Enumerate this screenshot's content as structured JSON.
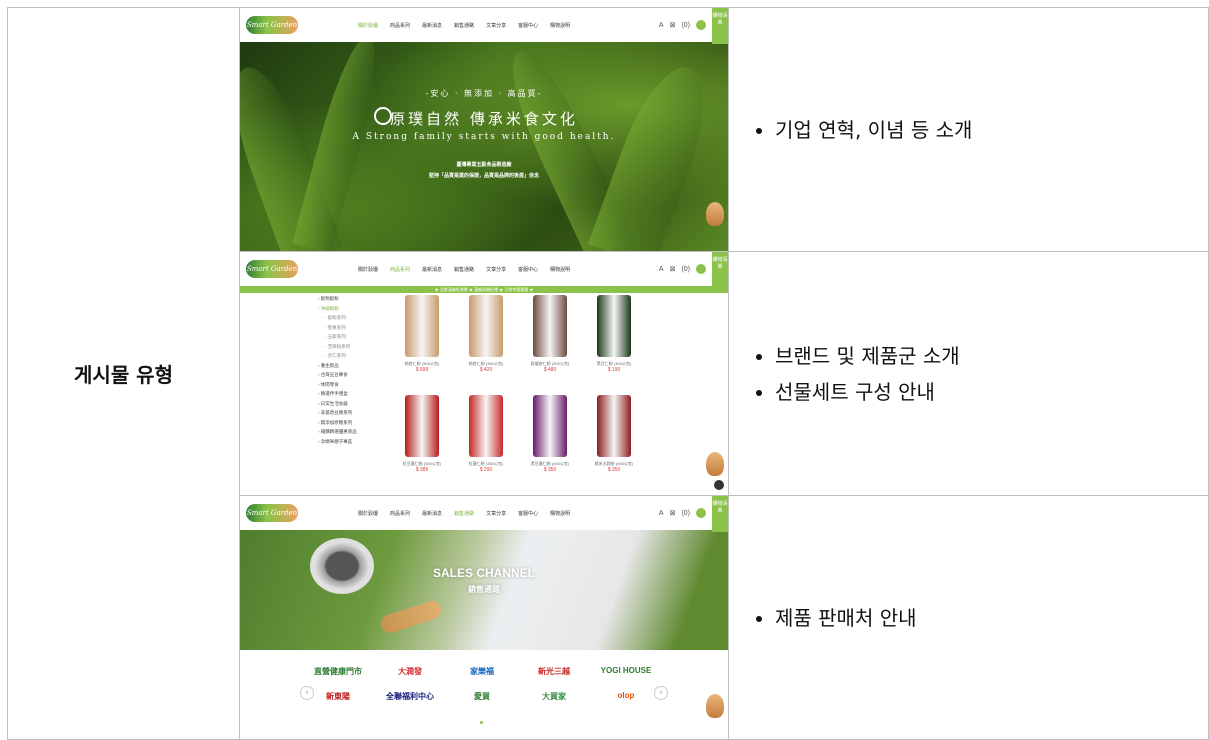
{
  "row_label": "게시물 유형",
  "rows": [
    {
      "bullets": [
        "기업 연혁, 이념 등 소개"
      ]
    },
    {
      "bullets": [
        "브랜드 및 제품군 소개",
        "선물세트 구성 안내"
      ]
    },
    {
      "bullets": [
        "제품 판매처 안내"
      ]
    }
  ],
  "site": {
    "logo_text": "Smart Garden",
    "nav": [
      "關於穀優",
      "商品系列",
      "最新消息",
      "銷售通路",
      "文章分享",
      "客服中心",
      "購物說明"
    ],
    "nav_icons": [
      "A",
      "⊠",
      "(0)"
    ],
    "cart_label": "購物清單"
  },
  "hero1": {
    "tagline": "-安心 · 無添加 · 高品質-",
    "title": "原璞自然  傳承米食文化",
    "english": "A Strong family starts with good health.",
    "line1": "臺灣專業五穀食品製造廠",
    "line2": "堅持「品質是業的保證，品質是品牌的後盾」信念"
  },
  "products": {
    "promo": "★ 全館滿額免運費 ★ 滿額再贈好禮 ★ 日常特惠優惠 ★",
    "categories": [
      {
        "label": "穀物穀粉",
        "type": "normal"
      },
      {
        "label": "沖調穀粉",
        "type": "green"
      },
      {
        "label": "穀粉系列",
        "type": "sub"
      },
      {
        "label": "堅果系列",
        "type": "sub"
      },
      {
        "label": "五穀系列",
        "type": "sub"
      },
      {
        "label": "芝麻粉系列",
        "type": "sub"
      },
      {
        "label": "杏仁系列",
        "type": "sub"
      },
      {
        "label": "養生飲品",
        "type": "normal"
      },
      {
        "label": "台灣豆豆專食",
        "type": "normal"
      },
      {
        "label": "休閒零食",
        "type": "normal"
      },
      {
        "label": "精選伴手禮盒",
        "type": "normal"
      },
      {
        "label": "日常生活食器",
        "type": "normal"
      },
      {
        "label": "非基改豆類系列",
        "type": "normal"
      },
      {
        "label": "無添加原糖系列",
        "type": "normal"
      },
      {
        "label": "箱購精選優惠商品",
        "type": "normal"
      },
      {
        "label": "孕媽咪親子專區",
        "type": "normal"
      }
    ],
    "items": [
      {
        "name": "純杏仁粉 (500公克)",
        "price": "$ 699",
        "color": "#c89a6a"
      },
      {
        "name": "純杏仁粉 (350公克)",
        "price": "$ 420",
        "color": "#c89a6a"
      },
      {
        "name": "穀優杏仁粉 (500公克)",
        "price": "$ 480",
        "color": "#6d4c41"
      },
      {
        "name": "黑豆仁粉 (400公克)",
        "price": "$ 190",
        "color": "#1b3a1b"
      },
      {
        "name": "紅豆薏仁粉 (500公克)",
        "price": "$ 389",
        "color": "#b71c1c"
      },
      {
        "name": "紅薏仁粉 (350公克)",
        "price": "$ 290",
        "color": "#c62828"
      },
      {
        "name": "黑豆薏仁粉 (400公克)",
        "price": "$ 350",
        "color": "#6a1b6a"
      },
      {
        "name": "糙米五穀粉 (450公克)",
        "price": "$ 350",
        "color": "#8d1e1e"
      }
    ]
  },
  "sales": {
    "title_en": "SALES CHANNEL",
    "title_zh": "銷售通路",
    "partners": [
      {
        "name": "直營健康門市",
        "color": "#2e7d32"
      },
      {
        "name": "大潤發",
        "color": "#d32f2f"
      },
      {
        "name": "家樂福",
        "color": "#1565c0"
      },
      {
        "name": "新光三越",
        "color": "#c62828"
      },
      {
        "name": "YOGI HOUSE",
        "color": "#2e7d32"
      },
      {
        "name": "新東陽",
        "color": "#b71c1c"
      },
      {
        "name": "全聯福利中心",
        "color": "#1a237e"
      },
      {
        "name": "愛買",
        "color": "#2e7d32"
      },
      {
        "name": "大買家",
        "color": "#388e3c"
      },
      {
        "name": "olop",
        "color": "#e65100"
      }
    ]
  }
}
